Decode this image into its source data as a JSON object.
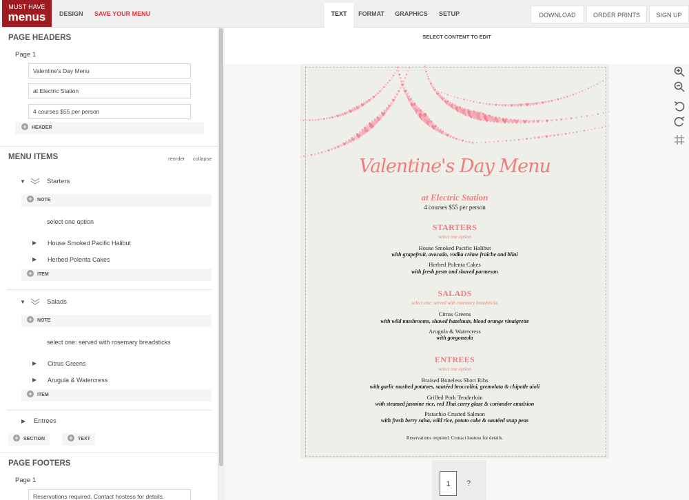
{
  "brand": {
    "line1": "MUST HAVE",
    "line2": "menus"
  },
  "topnav": {
    "design": "DESIGN",
    "save": "SAVE YOUR MENU"
  },
  "tabs": {
    "text": "TEXT",
    "format": "FORMAT",
    "graphics": "GRAPHICS",
    "setup": "SETUP"
  },
  "buttons": {
    "download": "DOWNLOAD",
    "prints": "ORDER PRINTS",
    "signup": "SIGN UP"
  },
  "left": {
    "page_headers_title": "PAGE HEADERS",
    "header_page_label": "Page 1",
    "header_fields": [
      "Valentine's Day Menu",
      "at Electric Station",
      "4 courses $55 per person"
    ],
    "add_header": "HEADER",
    "menu_items_title": "MENU ITEMS",
    "reorder": "reorder",
    "collapse": "collapse",
    "sections": [
      {
        "name": "Starters",
        "add_note": "NOTE",
        "note": "select one option",
        "items": [
          "House Smoked Pacific Halibut",
          "Herbed Polenta Cakes"
        ],
        "add_item": "ITEM"
      },
      {
        "name": "Salads",
        "add_note": "NOTE",
        "note": "select one: served with rosemary breadsticks",
        "items": [
          "Citrus Greens",
          "Arugula & Watercress"
        ],
        "add_item": "ITEM"
      },
      {
        "name": "Entrees"
      }
    ],
    "add_section": "SECTION",
    "add_text": "TEXT",
    "page_footers_title": "PAGE FOOTERS",
    "footer_page_label": "Page 1",
    "footer_field": "Reservations required. Contact hostess for details."
  },
  "editor": {
    "select_label": "SELECT CONTENT TO EDIT"
  },
  "menu": {
    "title": "Valentine's Day Menu",
    "subtitle": "at Electric Station",
    "price": "4 courses $55 per person",
    "sections": [
      {
        "name": "STARTERS",
        "note": "select one option",
        "items": [
          {
            "name": "House Smoked Pacific Halibut",
            "desc": "with grapefruit, avocado, vodka crème fraîche and blini"
          },
          {
            "name": "Herbed Polenta Cakes",
            "desc": "with fresh pesto and shaved parmesan"
          }
        ]
      },
      {
        "name": "SALADS",
        "note": "select one: served with rosemary breadsticks",
        "items": [
          {
            "name": "Citrus Greens",
            "desc": "with wild mushrooms, shaved hazelnuts, blood orange vinaigrette"
          },
          {
            "name": "Arugula & Watercress",
            "desc": "with gorgonzola"
          }
        ]
      },
      {
        "name": "ENTREES",
        "note": "select one option",
        "items": [
          {
            "name": "Braised Boneless Short Ribs",
            "desc": "with garlic mashed potatoes, sautéed broccolini, gremolata & chipotle aioli"
          },
          {
            "name": "Grilled Pork Tenderloin",
            "desc": "with steamed jasmine rice, red Thai curry glaze & coriander emulsion"
          },
          {
            "name": "Pistachio Crusted Salmon",
            "desc": "with fresh berry salsa, wild rice, potato cake & sautéed snap peas"
          }
        ]
      }
    ],
    "footer": "Reservations required. Contact hostess for details."
  },
  "pager": {
    "current": "1",
    "help": "?"
  },
  "colors": {
    "brand": "#9e1b22",
    "accent": "#e0343e",
    "menu_pink": "#ee7d7d"
  },
  "tools": [
    "zoom-in-icon",
    "zoom-out-icon",
    "undo-icon",
    "redo-icon",
    "grid-icon"
  ]
}
